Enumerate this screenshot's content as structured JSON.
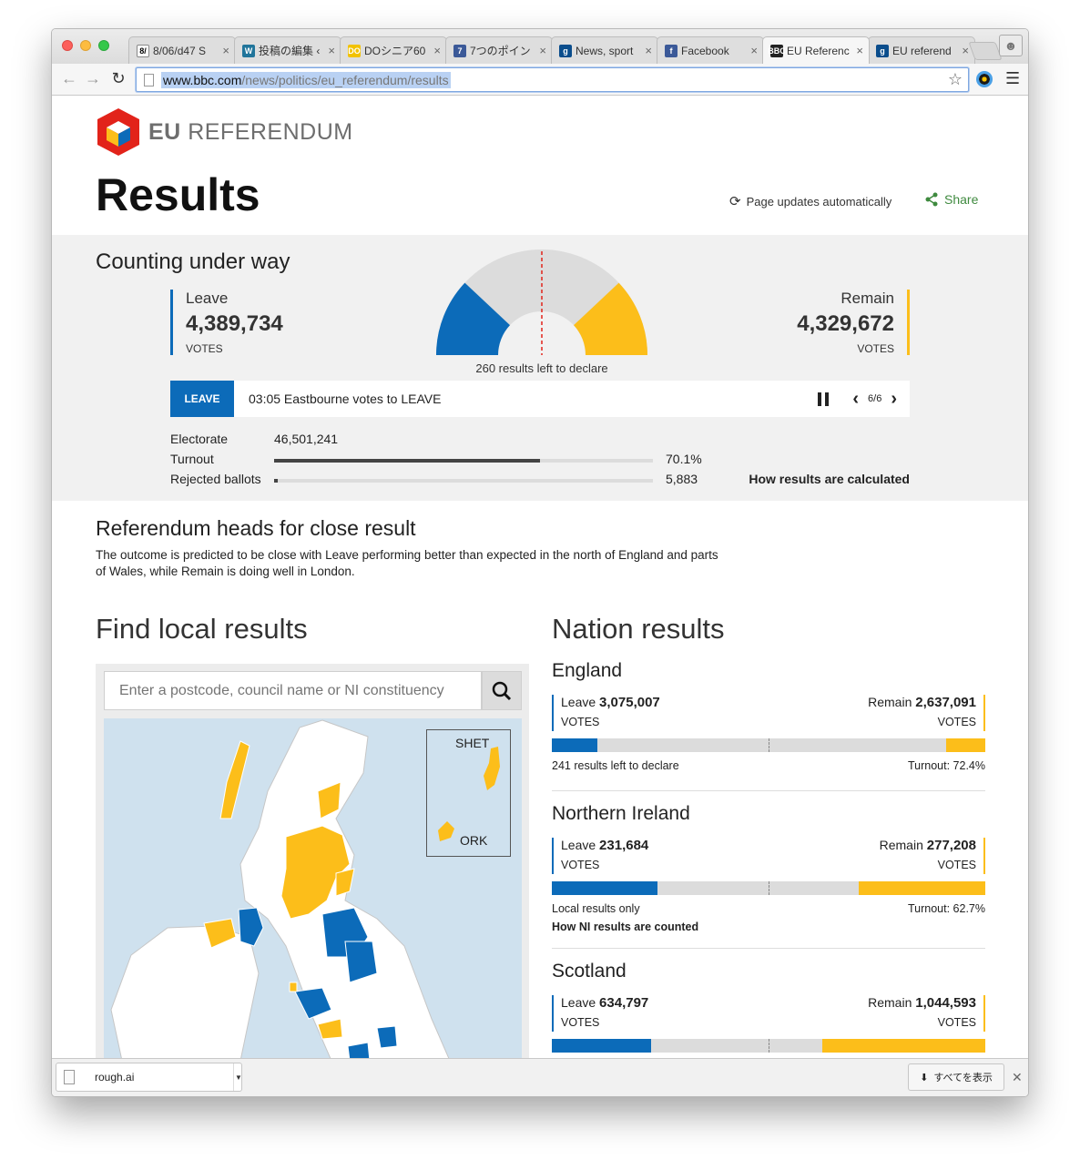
{
  "browser": {
    "tabs": [
      {
        "label": "8/06/d47 S",
        "favicon": "8/",
        "color": "#ffffff"
      },
      {
        "label": "投稿の編集 ‹",
        "favicon": "W",
        "color": "#21759b"
      },
      {
        "label": "DOシニア60",
        "favicon": "DO",
        "color": "#f2c200"
      },
      {
        "label": "7つのポイン",
        "favicon": "7",
        "color": "#3b5998"
      },
      {
        "label": "News, sport",
        "favicon": "g",
        "color": "#0a4d8c"
      },
      {
        "label": "Facebook",
        "favicon": "f",
        "color": "#3b5998"
      },
      {
        "label": "EU Referenc",
        "favicon": "BBC",
        "color": "#222222"
      },
      {
        "label": "EU referend",
        "favicon": "g",
        "color": "#0a4d8c"
      }
    ],
    "url_host": "www.bbc.com",
    "url_path": "/news/politics/eu_referendum/results"
  },
  "header": {
    "logo_bold": "EU",
    "logo_text": "REFERENDUM",
    "title": "Results",
    "auto_update": "Page updates automatically",
    "share": "Share"
  },
  "summary": {
    "status": "Counting under way",
    "leave": {
      "name": "Leave",
      "votes": "4,389,734",
      "unit": "VOTES"
    },
    "remain": {
      "name": "Remain",
      "votes": "4,329,672",
      "unit": "VOTES"
    },
    "left_to_declare": "260 results left to declare",
    "gauge": {
      "leave_share": 0.12,
      "remain_share": 0.12
    }
  },
  "ticker": {
    "badge": "LEAVE",
    "message": "03:05 Eastbourne votes to LEAVE",
    "counter": "6/6"
  },
  "stats": {
    "electorate_label": "Electorate",
    "electorate_value": "46,501,241",
    "turnout_label": "Turnout",
    "turnout_value": "70.1%",
    "turnout_fraction": 0.701,
    "rejected_label": "Rejected ballots",
    "rejected_value": "5,883",
    "rejected_fraction": 0.01,
    "how_calculated": "How results are calculated"
  },
  "headline": {
    "title": "Referendum heads for close result",
    "body": "The outcome is predicted to be close with Leave performing better than expected in the north of England and parts of Wales, while Remain is doing well in London."
  },
  "local": {
    "title": "Find local results",
    "search_placeholder": "Enter a postcode, council name or NI constituency",
    "inset_top": "SHET",
    "inset_bottom": "ORK"
  },
  "nations": {
    "title": "Nation results",
    "items": [
      {
        "name": "England",
        "leave_label": "Leave",
        "leave_votes": "3,075,007",
        "remain_label": "Remain",
        "remain_votes": "2,637,091",
        "unit": "VOTES",
        "leave_bar": 0.105,
        "remain_bar": 0.09,
        "foot_left": "241 results left to declare",
        "foot_right": "Turnout: 72.4%",
        "link": ""
      },
      {
        "name": "Northern Ireland",
        "leave_label": "Leave",
        "leave_votes": "231,684",
        "remain_label": "Remain",
        "remain_votes": "277,208",
        "unit": "VOTES",
        "leave_bar": 0.243,
        "remain_bar": 0.292,
        "foot_left": "Local results only",
        "foot_right": "Turnout: 62.7%",
        "link": "How NI results are counted"
      },
      {
        "name": "Scotland",
        "leave_label": "Leave",
        "leave_votes": "634,797",
        "remain_label": "Remain",
        "remain_votes": "1,044,593",
        "unit": "VOTES",
        "leave_bar": 0.23,
        "remain_bar": 0.376,
        "foot_left": "",
        "foot_right": "",
        "link": ""
      }
    ]
  },
  "downloads": {
    "file_name": "rough.ai",
    "show_all": "すべてを表示"
  },
  "colors": {
    "leave": "#0c6bb9",
    "remain": "#fcbe1a",
    "share": "#3f8a3f"
  }
}
